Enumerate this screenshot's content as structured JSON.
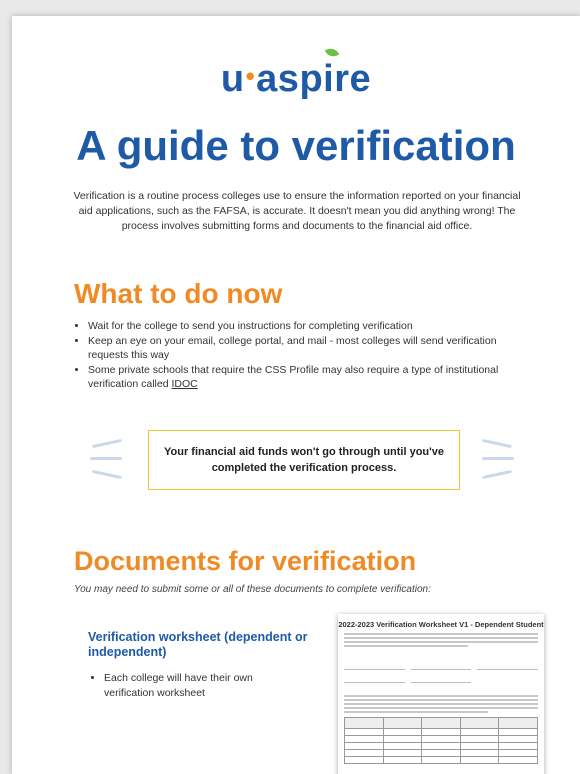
{
  "logo": {
    "part_u": "u",
    "dot": "•",
    "part_asp": "asp",
    "part_i": "i",
    "part_re": "re"
  },
  "title": "A guide to verification",
  "intro": "Verification is a routine process colleges use to ensure the information reported on your financial aid applications, such as the FAFSA, is accurate. It doesn't mean you did anything wrong! The process involves submitting forms and documents to the financial aid office.",
  "what_to_do": {
    "heading": "What to do now",
    "items": [
      "Wait for the college to send you instructions for completing verification",
      "Keep an eye on your email, college portal, and mail - most colleges will send verification requests this way"
    ],
    "item3_text": "Some private schools that require the CSS Profile may also require a type of institutional verification called ",
    "item3_link": "IDOC"
  },
  "callout": "Your financial aid funds won't go through until you've completed the verification process.",
  "documents": {
    "heading": "Documents for verification",
    "subtitle": "You may need to submit some or all of these documents to complete verification:",
    "worksheet_heading": "Verification worksheet (dependent or independent)",
    "worksheet_items": [
      "Each college will have their own verification worksheet"
    ],
    "thumbnail_title": "2022-2023 Verification Worksheet V1 - Dependent Student"
  },
  "colors": {
    "brand_blue": "#1f5aa6",
    "brand_orange": "#f08a24",
    "leaf_green": "#6fbf44",
    "callout_border": "#f2c230"
  }
}
